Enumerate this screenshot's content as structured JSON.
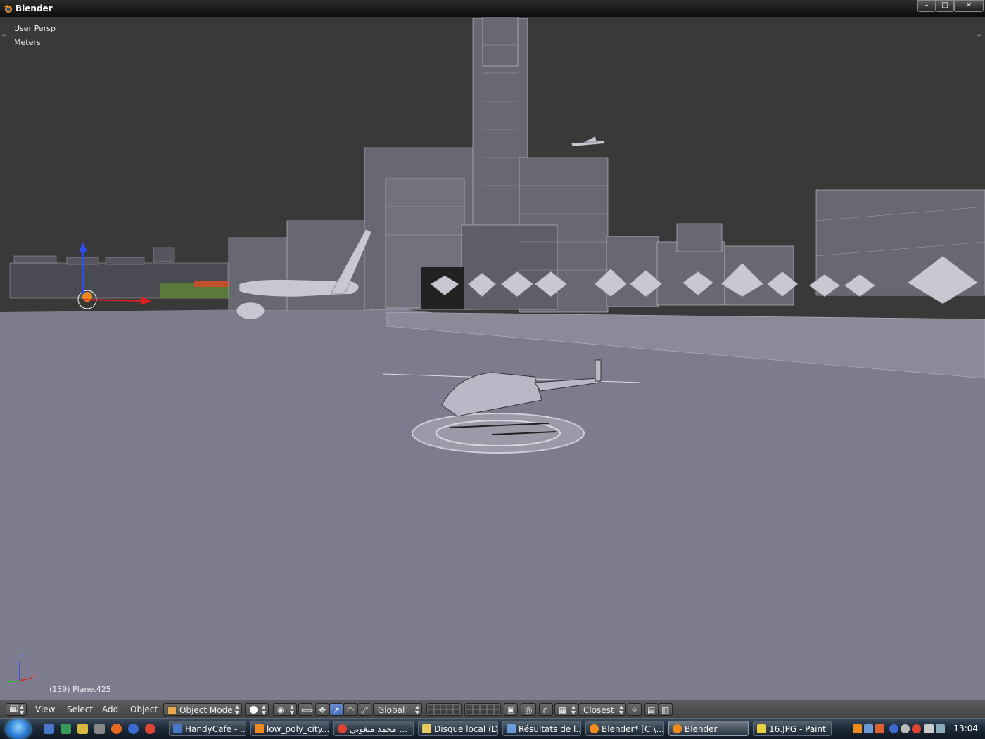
{
  "window": {
    "title": "Blender",
    "minimize": "–",
    "maximize": "□",
    "close": "✕"
  },
  "viewport": {
    "view_name": "User Persp",
    "units": "Meters",
    "active_object": "(139) Plane.425",
    "axis_z": "z",
    "axis_x": "x"
  },
  "header": {
    "editor_icon": "3d-view-icon",
    "menus": [
      "View",
      "Select",
      "Add",
      "Object"
    ],
    "mode": "Object Mode",
    "orientation": "Global",
    "snap_target": "Closest"
  },
  "taskbar": {
    "tasks": [
      {
        "label": "HandyCafe - ...",
        "icon_color": "#4a78c8"
      },
      {
        "label": "low_poly_city...",
        "icon_color": "#f08a1c"
      },
      {
        "label": "محمد ميغوني ...",
        "icon_color": "#dd4433"
      },
      {
        "label": "Disque local (D:)",
        "icon_color": "#e8c860"
      },
      {
        "label": "Résultats de l...",
        "icon_color": "#6a9ad8"
      },
      {
        "label": "Blender* [C:\\...",
        "icon_color": "#f08a1c"
      },
      {
        "label": "Blender",
        "icon_color": "#f08a1c"
      },
      {
        "label": "16.JPG - Paint",
        "icon_color": "#e8d040"
      }
    ],
    "clock": "13:04"
  },
  "colors": {
    "viewport_bg": "#393939",
    "ground": "#7c7c8e",
    "selection": "#f08a1c"
  }
}
